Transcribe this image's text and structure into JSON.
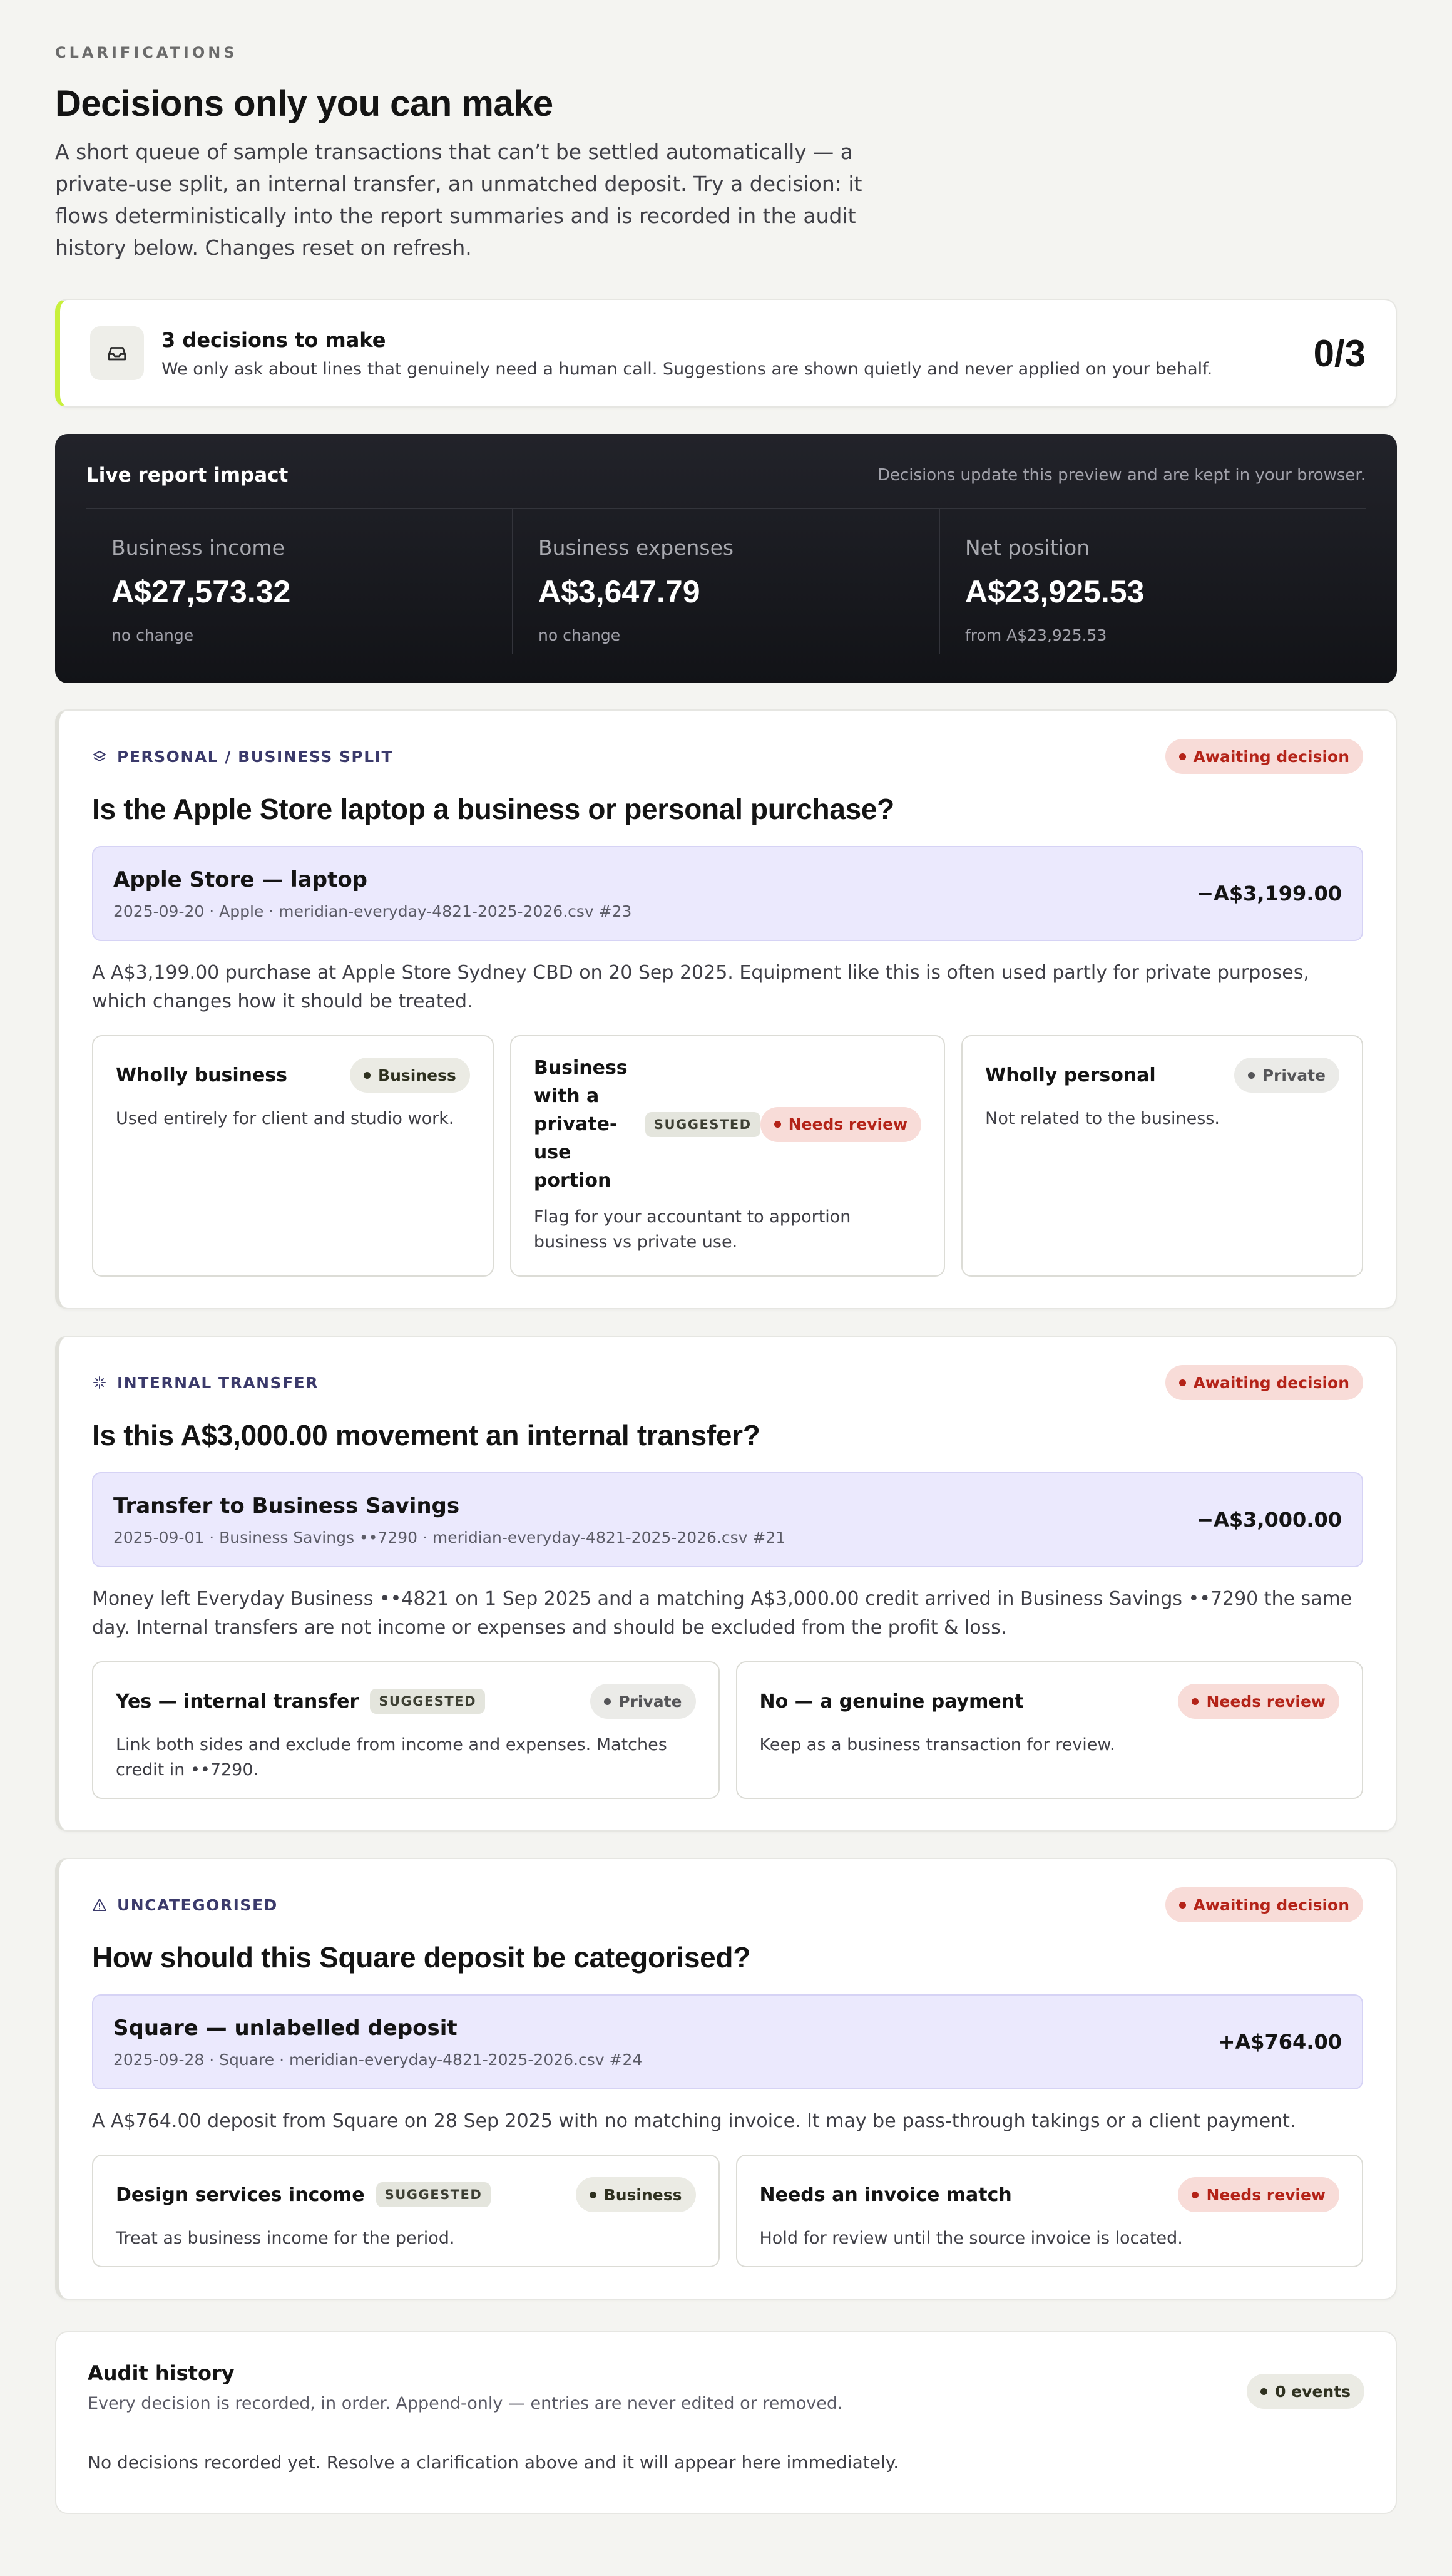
{
  "header": {
    "eyebrow": "CLARIFICATIONS",
    "title": "Decisions only you can make",
    "intro": "A short queue of sample transactions that can’t be settled automatically — a private-use split, an internal transfer, an unmatched deposit. Try a decision: it flows deterministically into the report summaries and is recorded in the audit history below. Changes reset on refresh."
  },
  "summary": {
    "icon": "inbox-icon",
    "title": "3 decisions to make",
    "subtitle": "We only ask about lines that genuinely need a human call. Suggestions are shown quietly and never applied on your behalf.",
    "count": "0/3",
    "accent": "#c8f03c"
  },
  "impact": {
    "title": "Live report impact",
    "note": "Decisions update this preview and are kept in your browser.",
    "metrics": [
      {
        "label": "Business income",
        "value": "A$27,573.32",
        "sub": "no change"
      },
      {
        "label": "Business expenses",
        "value": "A$3,647.79",
        "sub": "no change"
      },
      {
        "label": "Net position",
        "value": "A$23,925.53",
        "sub": "from A$23,925.53"
      }
    ]
  },
  "cards": [
    {
      "kind": "PERSONAL / BUSINESS SPLIT",
      "kind_icon": "layers-icon",
      "status": "Awaiting decision",
      "question": "Is the Apple Store laptop a business or personal purchase?",
      "txn": {
        "title": "Apple Store — laptop",
        "meta": "2025-09-20 · Apple · meridian-everyday-4821-2025-2026.csv #23",
        "amount": "−A$3,199.00"
      },
      "description": "A A$3,199.00 purchase at Apple Store Sydney CBD on 20 Sep 2025. Equipment like this is often used partly for private purposes, which changes how it should be treated.",
      "options": [
        {
          "title": "Wholly business",
          "badge": "Business",
          "desc": "Used entirely for client and studio work."
        },
        {
          "title": "Business with a private-use portion",
          "suggested": "SUGGESTED",
          "badge": "Needs review",
          "desc": "Flag for your accountant to apportion business vs private use."
        },
        {
          "title": "Wholly personal",
          "badge": "Private",
          "desc": "Not related to the business."
        }
      ]
    },
    {
      "kind": "INTERNAL TRANSFER",
      "kind_icon": "sparkle-icon",
      "status": "Awaiting decision",
      "question": "Is this A$3,000.00 movement an internal transfer?",
      "txn": {
        "title": "Transfer to Business Savings",
        "meta": "2025-09-01 · Business Savings ••7290 · meridian-everyday-4821-2025-2026.csv #21",
        "amount": "−A$3,000.00"
      },
      "description": "Money left Everyday Business ••4821 on 1 Sep 2025 and a matching A$3,000.00 credit arrived in Business Savings ••7290 the same day. Internal transfers are not income or expenses and should be excluded from the profit & loss.",
      "options": [
        {
          "title": "Yes — internal transfer",
          "suggested": "SUGGESTED",
          "badge": "Private",
          "desc": "Link both sides and exclude from income and expenses. Matches credit in ••7290."
        },
        {
          "title": "No — a genuine payment",
          "badge": "Needs review",
          "desc": "Keep as a business transaction for review."
        }
      ]
    },
    {
      "kind": "UNCATEGORISED",
      "kind_icon": "warning-triangle-icon",
      "status": "Awaiting decision",
      "question": "How should this Square deposit be categorised?",
      "txn": {
        "title": "Square — unlabelled deposit",
        "meta": "2025-09-28 · Square · meridian-everyday-4821-2025-2026.csv #24",
        "amount": "+A$764.00"
      },
      "description": "A A$764.00 deposit from Square on 28 Sep 2025 with no matching invoice. It may be pass-through takings or a client payment.",
      "options": [
        {
          "title": "Design services income",
          "suggested": "SUGGESTED",
          "badge": "Business",
          "desc": "Treat as business income for the period."
        },
        {
          "title": "Needs an invoice match",
          "badge": "Needs review",
          "desc": "Hold for review until the source invoice is located."
        }
      ]
    }
  ],
  "audit": {
    "title": "Audit history",
    "subtitle": "Every decision is recorded, in order. Append-only — entries are never edited or removed.",
    "events": "0 events",
    "empty": "No decisions recorded yet. Resolve a clarification above and it will appear here immediately."
  }
}
